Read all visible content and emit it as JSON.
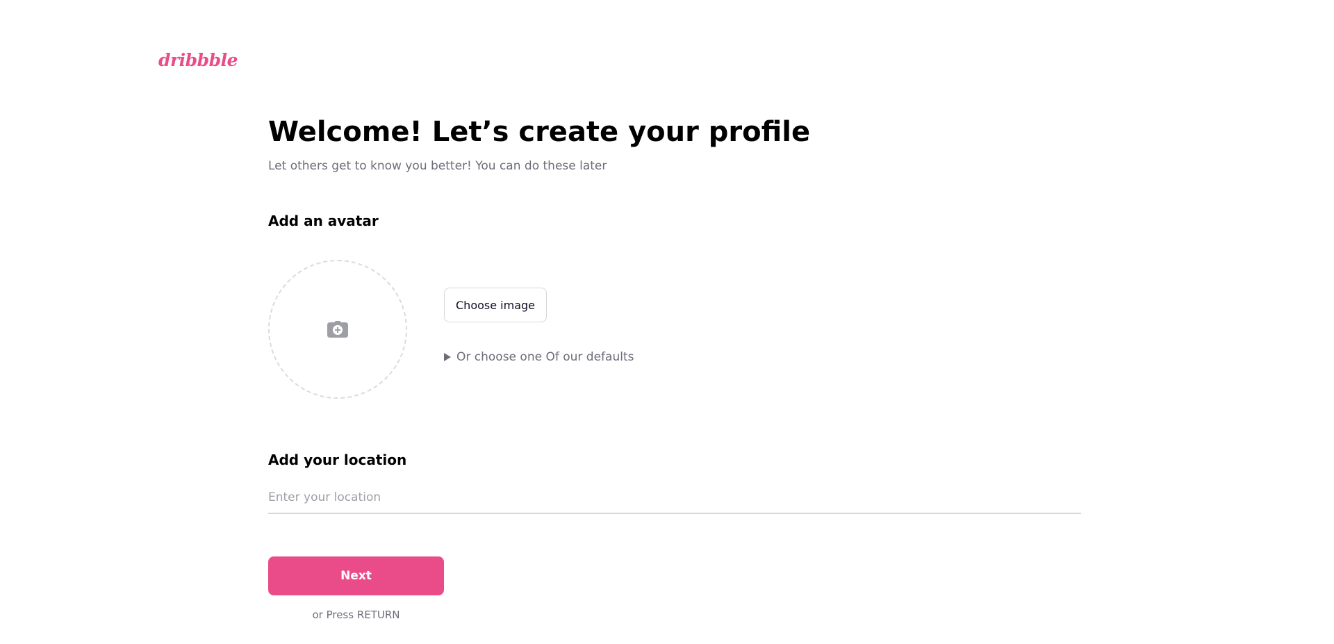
{
  "brand": {
    "logo_text": "dribbble",
    "color": "#ea4c89"
  },
  "header": {
    "title": "Welcome! Let’s create your profile",
    "subtitle": "Let others get to know you better! You can do these later"
  },
  "avatar": {
    "heading": "Add an avatar",
    "upload_icon": "camera-plus-icon",
    "choose_button_label": "Choose image",
    "defaults_toggle_label": "Or choose one Of our defaults",
    "toggle_icon": "triangle-right-icon"
  },
  "location": {
    "heading": "Add your location",
    "placeholder": "Enter your location",
    "value": ""
  },
  "actions": {
    "next_label": "Next",
    "hint": "or Press RETURN",
    "accent": "#ea4c89"
  }
}
